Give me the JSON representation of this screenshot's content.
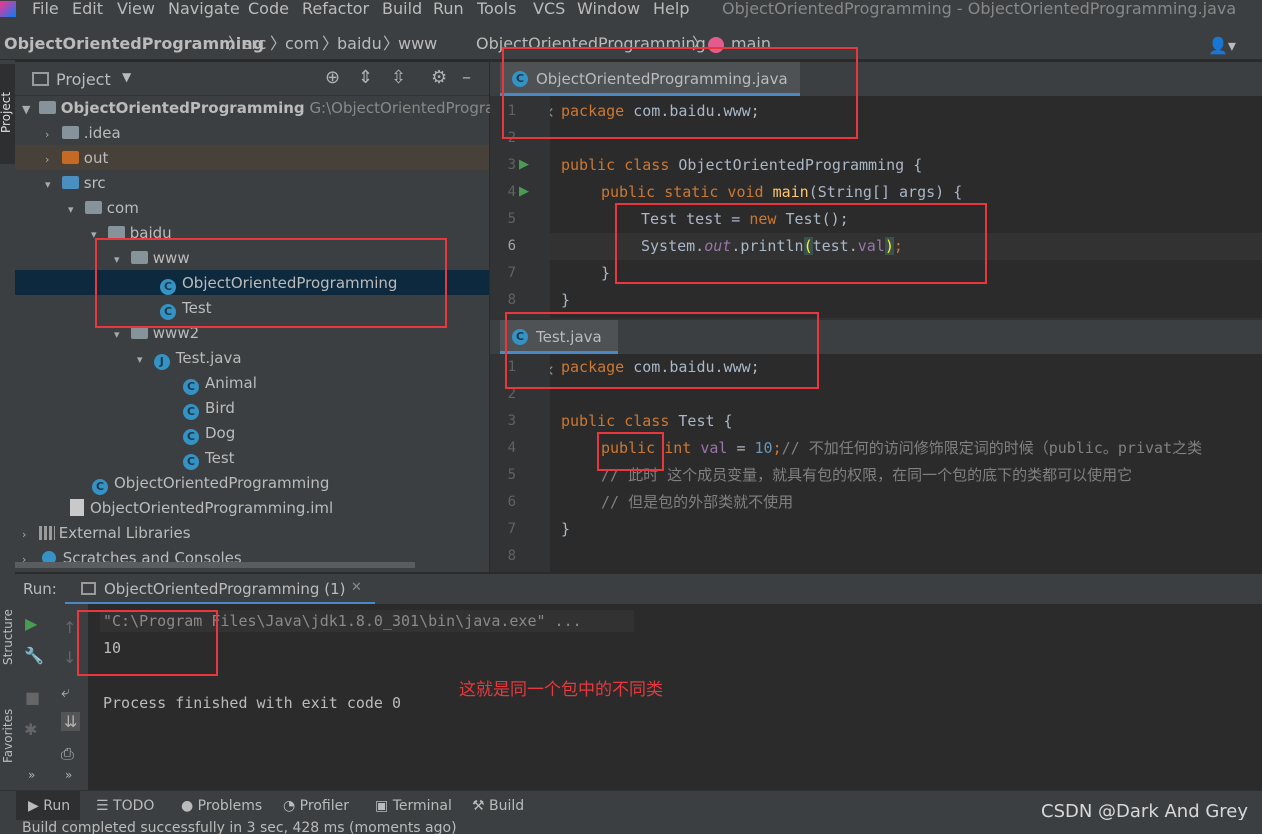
{
  "menubar": {
    "items": [
      "File",
      "Edit",
      "View",
      "Navigate",
      "Code",
      "Refactor",
      "Build",
      "Run",
      "Tools",
      "VCS",
      "Window",
      "Help"
    ],
    "title": "ObjectOrientedProgramming - ObjectOrientedProgramming.java"
  },
  "breadcrumb": [
    "ObjectOrientedProgramming",
    "src",
    "com",
    "baidu",
    "www",
    "ObjectOrientedProgramming",
    "main"
  ],
  "project_panel": {
    "title": "Project",
    "side_tab": "Project",
    "tree": [
      {
        "label": "ObjectOrientedProgramming",
        "extra": "G:\\ObjectOrientedProgram"
      },
      {
        "label": ".idea"
      },
      {
        "label": "out"
      },
      {
        "label": "src"
      },
      {
        "label": "com"
      },
      {
        "label": "baidu"
      },
      {
        "label": "www"
      },
      {
        "label": "ObjectOrientedProgramming"
      },
      {
        "label": "Test"
      },
      {
        "label": "www2"
      },
      {
        "label": "Test.java"
      },
      {
        "label": "Animal"
      },
      {
        "label": "Bird"
      },
      {
        "label": "Dog"
      },
      {
        "label": "Test"
      },
      {
        "label": "ObjectOrientedProgramming"
      },
      {
        "label": "ObjectOrientedProgramming.iml"
      },
      {
        "label": "External Libraries"
      },
      {
        "label": "Scratches and Consoles"
      }
    ]
  },
  "editor1": {
    "tab": "ObjectOrientedProgramming.java",
    "line_numbers": [
      "1",
      "2",
      "3",
      "4",
      "5",
      "6",
      "7",
      "8"
    ],
    "lines": {
      "l1_kw": "package",
      "l1_rest": " com.baidu.www;",
      "l3_kw": "public class",
      "l3_rest": " ObjectOrientedProgramming {",
      "l4_kw": "public static void",
      "l4_fn": "main",
      "l4_rest": "(String[] args) {",
      "l5_a": "Test test = ",
      "l5_kw": "new",
      "l5_b": " Test();",
      "l6_a": "System.",
      "l6_out": "out",
      "l6_b": ".println",
      "l6_c": "(",
      "l6_d": "test.",
      "l6_val": "val",
      "l6_e": ")",
      "l6_f": ";",
      "l7": "}",
      "l8": "}"
    }
  },
  "editor2": {
    "tab": "Test.java",
    "line_numbers": [
      "1",
      "2",
      "3",
      "4",
      "5",
      "6",
      "7",
      "8"
    ],
    "lines": {
      "l1_kw": "package",
      "l1_rest": " com.baidu.www;",
      "l3_kw": "public class",
      "l3_rest": " Test {",
      "l4_kw1": "public",
      "l4_kw2": " int ",
      "l4_val": "val",
      "l4_eq": " = ",
      "l4_num": "10",
      "l4_semi": ";",
      "l4_cmt": "//  不加任何的访问修饰限定词的时候（public。privat之类",
      "l5_cmt": "// 此时 这个成员变量，就具有包的权限，在同一个包的底下的类都可以使用它",
      "l6_cmt": "// 但是包的外部类就不使用",
      "l7": "}"
    }
  },
  "run": {
    "label": "Run:",
    "tab": "ObjectOrientedProgramming (1)",
    "cmd": "\"C:\\Program Files\\Java\\jdk1.8.0_301\\bin\\java.exe\" ...",
    "output": "10",
    "finished": "Process finished with exit code 0",
    "annotation": "这就是同一个包中的不同类"
  },
  "side_tabs": {
    "structure": "Structure",
    "favorites": "Favorites"
  },
  "bottom_tabs": [
    "Run",
    "TODO",
    "Problems",
    "Profiler",
    "Terminal",
    "Build"
  ],
  "watermark": "CSDN @Dark And Grey",
  "status": "Build completed successfully in 3 sec, 428 ms (moments ago)",
  "colors": {
    "accent": "#4a88c7",
    "annotation_red": "#e8383d",
    "keyword": "#cc7832",
    "function": "#ffc66d"
  }
}
